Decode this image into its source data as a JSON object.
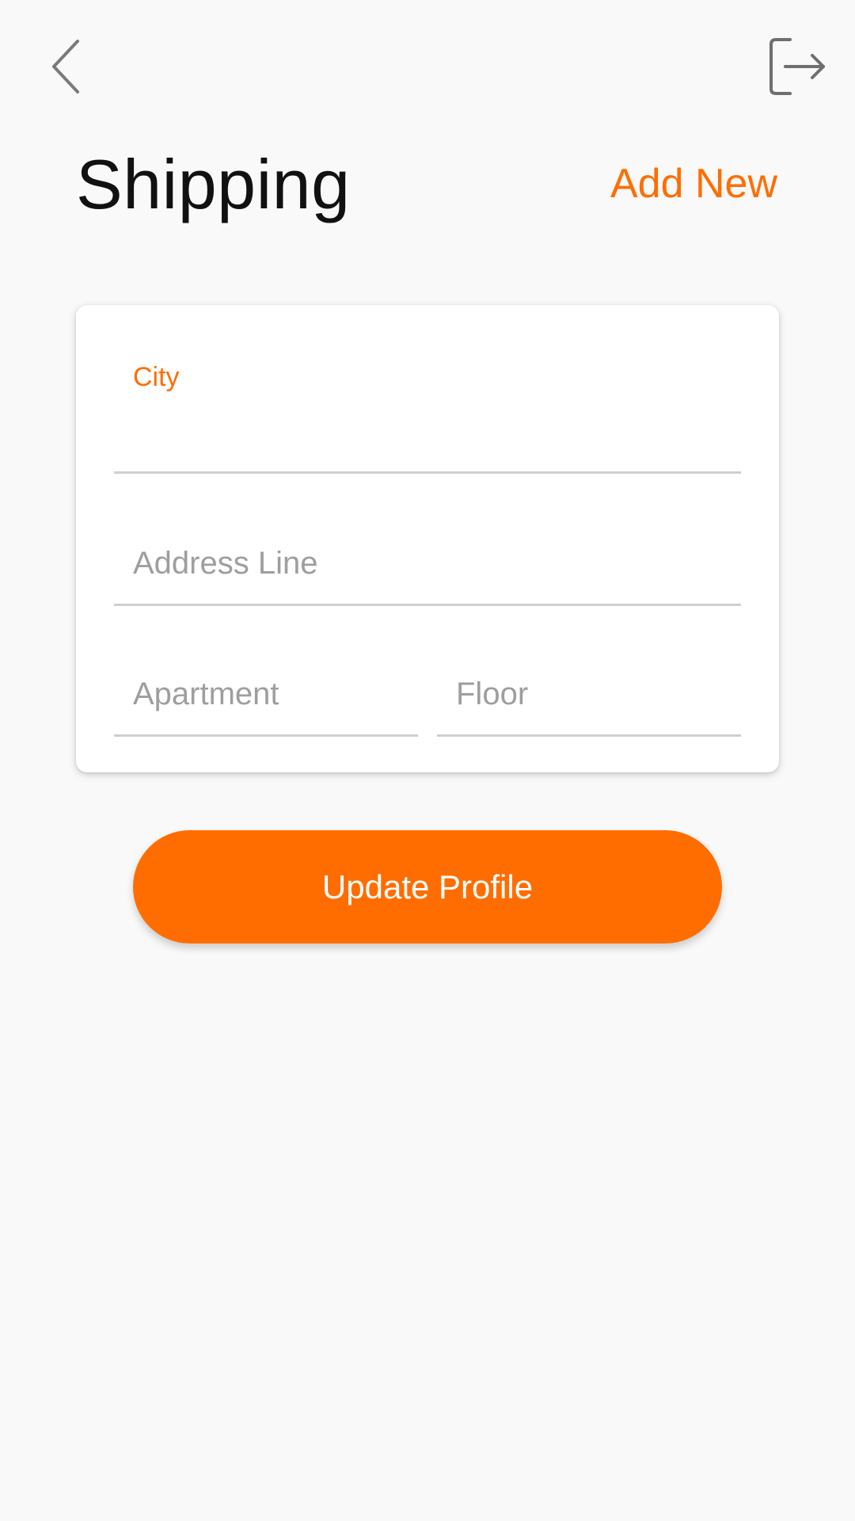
{
  "header": {
    "back_icon": "chevron-left-icon",
    "logout_icon": "logout-icon",
    "title": "Shipping",
    "add_new_label": "Add New"
  },
  "form": {
    "city": {
      "label": "City",
      "value": ""
    },
    "address": {
      "placeholder": "Address Line",
      "value": ""
    },
    "apartment": {
      "placeholder": "Apartment",
      "value": ""
    },
    "floor": {
      "placeholder": "Floor",
      "value": ""
    }
  },
  "actions": {
    "update_label": "Update Profile"
  },
  "colors": {
    "accent": "#ff6d00",
    "background": "#f9f9f9",
    "card": "#ffffff",
    "divider": "#cfcfcf",
    "placeholder": "#9e9e9e"
  }
}
